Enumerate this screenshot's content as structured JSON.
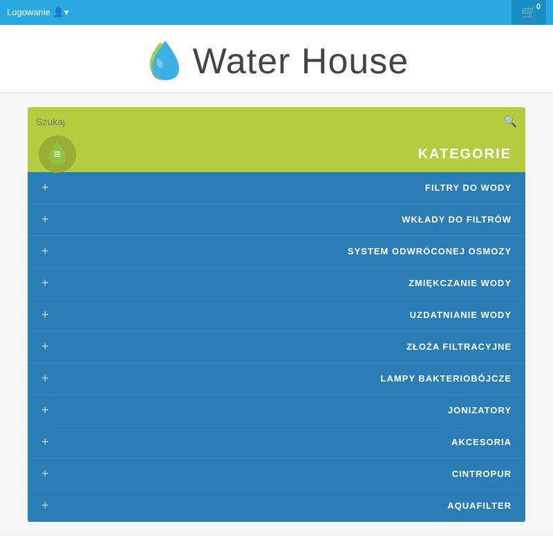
{
  "topbar": {
    "login_label": "Logowanie",
    "cart_count": "0",
    "cart_icon": "🛒"
  },
  "header": {
    "site_title": "Water House",
    "logo_alt": "Water House logo"
  },
  "search": {
    "placeholder": "Szukaj",
    "button_label": "🔍"
  },
  "categories": {
    "title": "KATEGORIE",
    "hamburger_icon": "≡",
    "items": [
      {
        "label": "FILTRY DO WODY"
      },
      {
        "label": "WKŁADY DO FILTRÓW"
      },
      {
        "label": "SYSTEM ODWRÓCONEJ OSMOZY"
      },
      {
        "label": "ZMIĘKCZANIE WODY"
      },
      {
        "label": "UZDATNIANIE WODY"
      },
      {
        "label": "ZŁOŻA FILTRACYJNE"
      },
      {
        "label": "LAMPY BAKTERIOBÓJCZE"
      },
      {
        "label": "JONIZATORY"
      },
      {
        "label": "AKCESORIA"
      },
      {
        "label": "CINTROPUR"
      },
      {
        "label": "AQUAFILTER"
      }
    ]
  },
  "colors": {
    "topbar_blue": "#29a9e0",
    "category_blue": "#2a7db5",
    "lime_green": "#b5cc3f"
  }
}
